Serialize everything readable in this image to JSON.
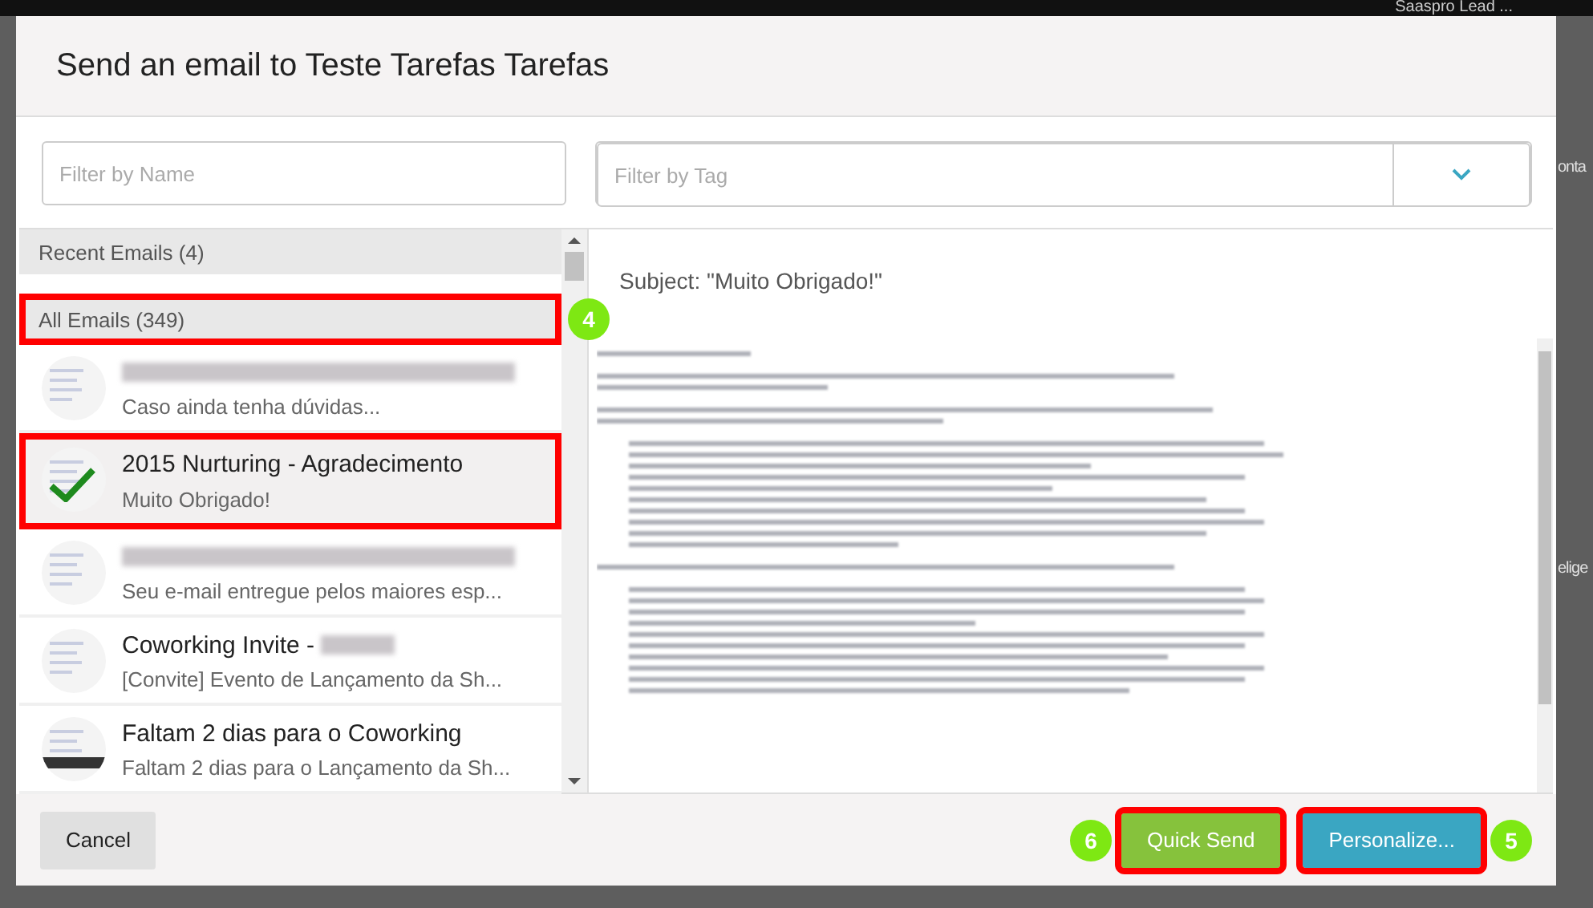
{
  "background": {
    "account": "Saaspro Lead ...",
    "fragments": [
      "onta",
      "elige"
    ]
  },
  "dialog": {
    "title": "Send an email to Teste Tarefas Tarefas",
    "filters": {
      "name_placeholder": "Filter by Name",
      "tag_placeholder": "Filter by Tag"
    },
    "sections": [
      {
        "label": "Recent Emails (4)",
        "highlighted": false
      },
      {
        "label": "All Emails (349)",
        "highlighted": true,
        "callout": "4",
        "emails": [
          {
            "title_blurred": true,
            "subtitle": "Caso ainda tenha dúvidas...",
            "selected": false,
            "highlighted": false
          },
          {
            "title": "2015 Nurturing - Agradecimento",
            "subtitle": "Muito Obrigado!",
            "selected": true,
            "highlighted": true
          },
          {
            "title_blurred": true,
            "subtitle": "Seu e-mail entregue pelos maiores esp...",
            "selected": false,
            "highlighted": false
          },
          {
            "title": "Coworking Invite -",
            "title_suffix_blurred": true,
            "subtitle": "[Convite] Evento de Lançamento da Sh...",
            "selected": false,
            "highlighted": false
          },
          {
            "title": "Faltam 2 dias para o Coworking",
            "subtitle": "Faltam 2 dias para o Lançamento da Sh...",
            "selected": false,
            "highlighted": false
          }
        ]
      }
    ],
    "preview": {
      "subject": "Subject: \"Muito Obrigado!\""
    },
    "buttons": [
      {
        "label": "Cancel",
        "kind": "cancel",
        "highlighted": false
      },
      {
        "label": "Quick Send",
        "kind": "send",
        "highlighted": true,
        "callout": "6"
      },
      {
        "label": "Personalize...",
        "kind": "personalize",
        "highlighted": true,
        "callout": "5"
      }
    ]
  }
}
